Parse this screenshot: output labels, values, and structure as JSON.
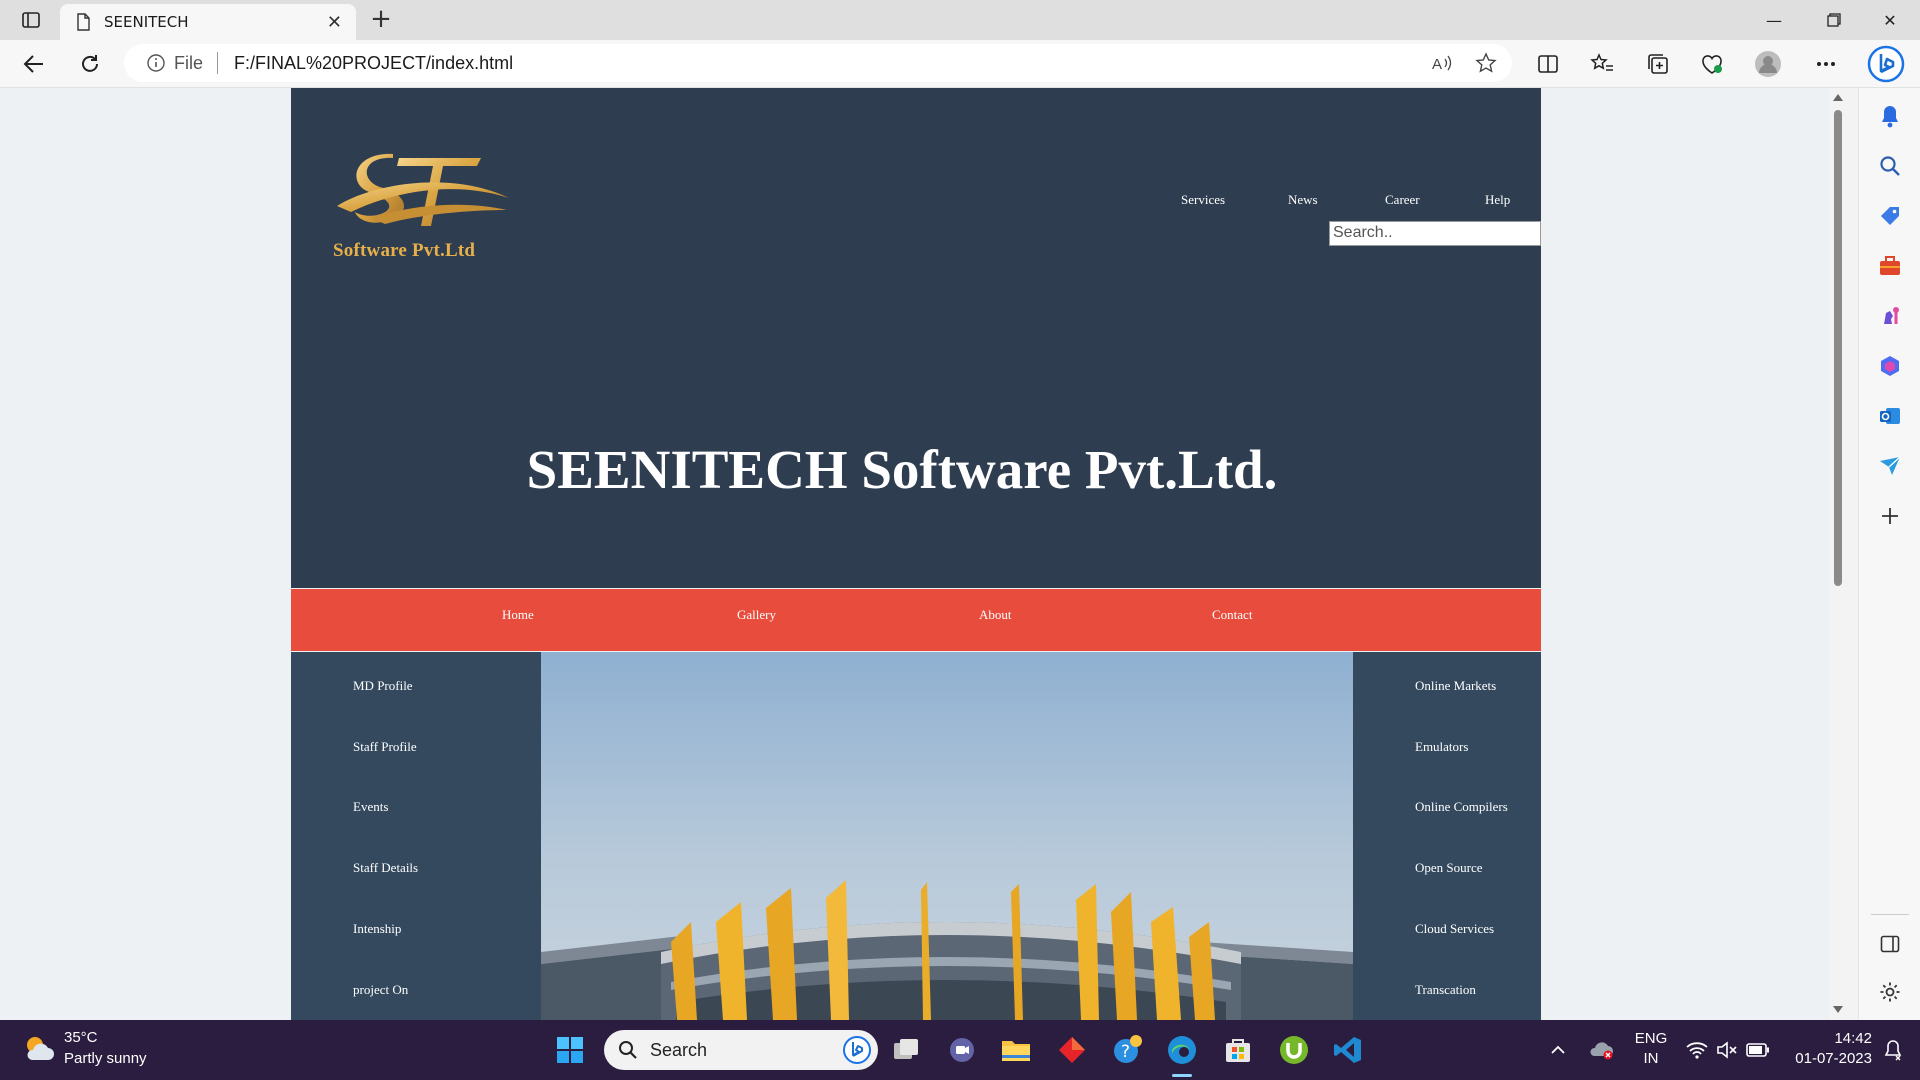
{
  "browser": {
    "tab_title": "SEENITECH",
    "address_scheme_label": "File",
    "url": "F:/FINAL%20PROJECT/index.html"
  },
  "site": {
    "logo_caption": "Software Pvt.Ltd",
    "top_nav": [
      "Services",
      "News",
      "Career",
      "Help"
    ],
    "search_placeholder": "Search..",
    "hero_title": "SEENITECH Software Pvt.Ltd.",
    "main_nav": [
      "Home",
      "Gallery",
      "About",
      "Contact"
    ],
    "left_menu": [
      "MD Profile",
      "Staff Profile",
      "Events",
      "Staff Details",
      "Intenship",
      "project On"
    ],
    "right_menu": [
      "Online Markets",
      "Emulators",
      "Online Compilers",
      "Open Source",
      "Cloud Services",
      "Transcation"
    ],
    "colors": {
      "header_bg": "#2e3d50",
      "nav_red": "#e74c3c",
      "side_bg": "#34495e",
      "logo_gold": "#e8b04a"
    }
  },
  "taskbar": {
    "weather_temp": "35°C",
    "weather_desc": "Partly sunny",
    "search_label": "Search",
    "lang_top": "ENG",
    "lang_bottom": "IN",
    "time": "14:42",
    "date": "01-07-2023"
  }
}
